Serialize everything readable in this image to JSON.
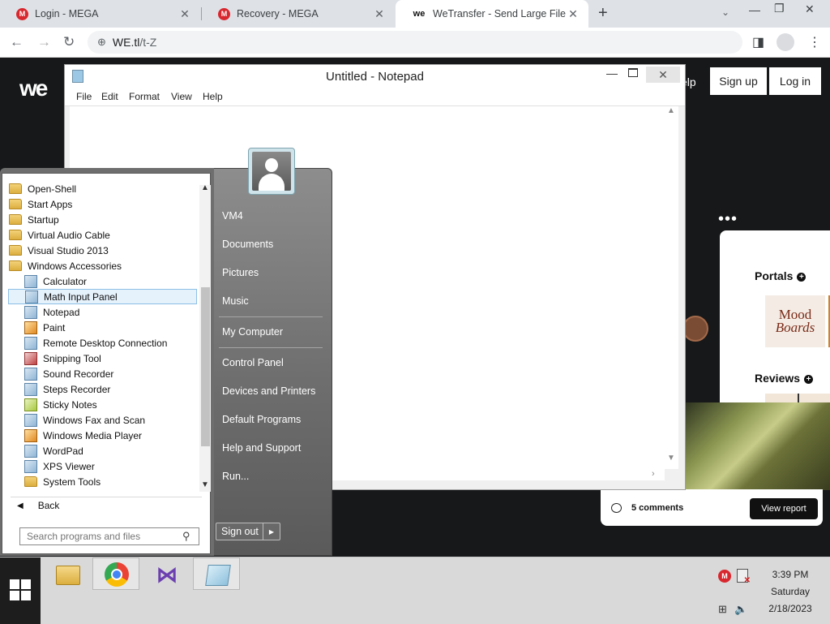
{
  "browser": {
    "tabs": [
      {
        "label": "Login - MEGA",
        "favicon": "M",
        "active": false
      },
      {
        "label": "Recovery - MEGA",
        "favicon": "M",
        "active": false
      },
      {
        "label": "WeTransfer - Send Large Files &",
        "favicon": "we",
        "active": true
      }
    ],
    "close_glyph": "✕",
    "new_tab_glyph": "+",
    "tab_search_glyph": "⌄",
    "window_controls": {
      "minimize": "—",
      "restore": "❐",
      "close": "✕"
    },
    "nav": {
      "back": "←",
      "forward": "→",
      "reload": "↻"
    },
    "url_host": "WE.tl",
    "url_path": "/t-Z",
    "globe_glyph": "⊕",
    "sidepanel_glyph": "◨",
    "menu_glyph": "⋮"
  },
  "wetransfer": {
    "logo": "we",
    "help_partial": "elp",
    "signup": "Sign up",
    "login": "Log in",
    "dots": "•••",
    "portals": "Portals",
    "reviews": "Reviews",
    "plus_glyph": "+",
    "mood_line1": "Mood",
    "mood_line2": "Boards",
    "comments": "5 comments",
    "view_report": "View report"
  },
  "notepad": {
    "title": "Untitled - Notepad",
    "menus": [
      "File",
      "Edit",
      "Format",
      "View",
      "Help"
    ],
    "content": "",
    "min_glyph": "—",
    "close_glyph": "✕",
    "scroll_up": "▲",
    "scroll_down": "▼",
    "scroll_right": "›"
  },
  "start_menu": {
    "programs": [
      {
        "label": "Open-Shell",
        "icon": "folder-icon",
        "level": 0
      },
      {
        "label": "Start Apps",
        "icon": "folder-icon",
        "level": 0
      },
      {
        "label": "Startup",
        "icon": "folder-icon",
        "level": 0
      },
      {
        "label": "Virtual Audio Cable",
        "icon": "folder-icon",
        "level": 0
      },
      {
        "label": "Visual Studio 2013",
        "icon": "folder-icon",
        "level": 0
      },
      {
        "label": "Windows Accessories",
        "icon": "folder-icon",
        "level": 0
      },
      {
        "label": "Calculator",
        "icon": "calculator-icon",
        "level": 1
      },
      {
        "label": "Math Input Panel",
        "icon": "math-input-icon",
        "level": 1,
        "selected": true
      },
      {
        "label": "Notepad",
        "icon": "notepad-icon",
        "level": 1
      },
      {
        "label": "Paint",
        "icon": "paint-icon",
        "level": 1
      },
      {
        "label": "Remote Desktop Connection",
        "icon": "remote-desktop-icon",
        "level": 1
      },
      {
        "label": "Snipping Tool",
        "icon": "snipping-tool-icon",
        "level": 1
      },
      {
        "label": "Sound Recorder",
        "icon": "microphone-icon",
        "level": 1
      },
      {
        "label": "Steps Recorder",
        "icon": "steps-recorder-icon",
        "level": 1
      },
      {
        "label": "Sticky Notes",
        "icon": "sticky-notes-icon",
        "level": 1
      },
      {
        "label": "Windows Fax and Scan",
        "icon": "fax-scan-icon",
        "level": 1
      },
      {
        "label": "Windows Media Player",
        "icon": "media-player-icon",
        "level": 1
      },
      {
        "label": "WordPad",
        "icon": "wordpad-icon",
        "level": 1
      },
      {
        "label": "XPS Viewer",
        "icon": "xps-viewer-icon",
        "level": 1
      },
      {
        "label": "System Tools",
        "icon": "folder-icon",
        "level": 1
      }
    ],
    "back": "Back",
    "back_glyph": "◀",
    "search_placeholder": "Search programs and files",
    "search_glyph": "⚲",
    "scroll_up": "▲",
    "scroll_down": "▼",
    "right_items": [
      "VM4",
      "Documents",
      "Pictures",
      "Music",
      "My Computer",
      "Control Panel",
      "Devices and Printers",
      "Default Programs",
      "Help and Support",
      "Run..."
    ],
    "sign_out": "Sign out",
    "sign_out_arrow": "▶"
  },
  "taskbar": {
    "pinned": [
      "file-explorer-icon",
      "chrome-icon",
      "visual-studio-icon",
      "notepad-icon"
    ],
    "vs_glyph": "⋈",
    "tray": {
      "mega": "M",
      "net_x": "✕",
      "speaker": "🔈",
      "network": "⊞"
    },
    "time": "3:39 PM",
    "day": "Saturday",
    "date": "2/18/2023"
  }
}
